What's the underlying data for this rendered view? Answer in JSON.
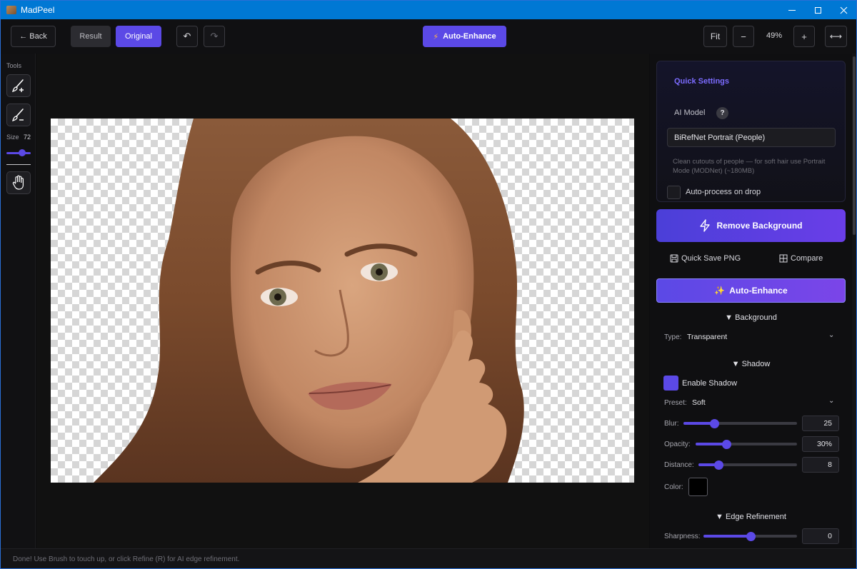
{
  "window": {
    "title": "MadPeel"
  },
  "toolbar": {
    "back_label": "← Back",
    "result_label": "Result",
    "original_label": "Original",
    "undo_icon": "↶",
    "redo_icon": "↷",
    "auto_enhance_label": "Auto-Enhance",
    "auto_enhance_icon": "⚡",
    "fit_label": "Fit",
    "zoom_out_label": "−",
    "zoom_level": "49%",
    "zoom_in_label": "+",
    "expand_label": "⟷"
  },
  "tools": {
    "heading": "Tools",
    "size_label": "Size",
    "size_value": "72",
    "size_fraction": 0.72
  },
  "panel": {
    "quick_settings": {
      "title": "Quick Settings",
      "ai_model_label": "AI Model",
      "help_glyph": "?",
      "model_value": "BiRefNet Portrait (People)",
      "model_description": "Clean cutouts of people — for soft hair use Portrait Mode (MODNet) (~180MB)",
      "auto_process_label": "Auto-process on drop",
      "auto_process_checked": false
    },
    "remove_bg_label": "Remove Background",
    "quick_save_label": "Quick Save PNG",
    "compare_label": "Compare",
    "auto_enhance_label": "Auto-Enhance",
    "background": {
      "header": "▼ Background",
      "type_label": "Type:",
      "type_value": "Transparent"
    },
    "shadow": {
      "header": "▼ Shadow",
      "enable_label": "Enable Shadow",
      "enabled": true,
      "preset_label": "Preset:",
      "preset_value": "Soft",
      "blur_label": "Blur:",
      "blur_value": "25",
      "blur_fraction": 0.27,
      "opacity_label": "Opacity:",
      "opacity_value": "30%",
      "opacity_fraction": 0.3,
      "distance_label": "Distance:",
      "distance_value": "8",
      "distance_fraction": 0.2,
      "color_label": "Color:",
      "color_value": "#000000"
    },
    "edge": {
      "header": "▼ Edge Refinement",
      "sharpness_label": "Sharpness:",
      "sharpness_value": "0",
      "sharpness_fraction": 0.5
    }
  },
  "status": {
    "message": "Done! Use Brush to touch up, or click Refine (R) for AI edge refinement."
  },
  "colors": {
    "accent": "#5b49e6",
    "titlebar": "#0078d4"
  }
}
